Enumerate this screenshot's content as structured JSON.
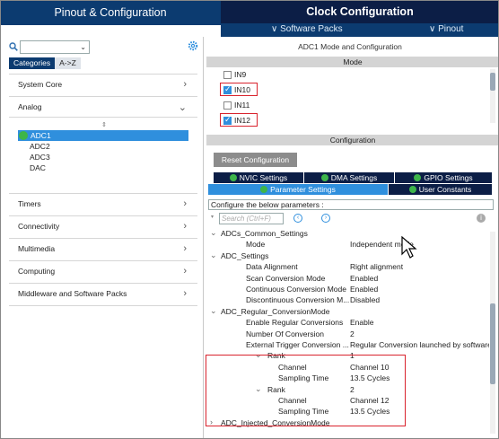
{
  "tabs": {
    "pinout": "Pinout & Configuration",
    "clock": "Clock Configuration"
  },
  "subbar": {
    "software_packs": "∨ Software Packs",
    "pinout": "∨ Pinout"
  },
  "left": {
    "category_tabs": [
      "Categories",
      "A->Z"
    ],
    "categories": [
      {
        "label": "System Core",
        "chevron": "›"
      },
      {
        "label": "Analog",
        "chevron": "⌄"
      },
      {
        "label": "Timers",
        "chevron": "›"
      },
      {
        "label": "Connectivity",
        "chevron": "›"
      },
      {
        "label": "Multimedia",
        "chevron": "›"
      },
      {
        "label": "Computing",
        "chevron": "›"
      },
      {
        "label": "Middleware and Software Packs",
        "chevron": "›"
      }
    ],
    "analog_items": [
      "ADC1",
      "ADC2",
      "ADC3",
      "DAC"
    ],
    "selected_item": "ADC1"
  },
  "right": {
    "title": "ADC1 Mode and Configuration",
    "mode_header": "Mode",
    "mode_items": [
      {
        "label": "IN9",
        "checked": false
      },
      {
        "label": "IN10",
        "checked": true
      },
      {
        "label": "IN11",
        "checked": false
      },
      {
        "label": "IN12",
        "checked": true
      }
    ],
    "config_header": "Configuration",
    "reset_button": "Reset Configuration",
    "settings_tabs_row1": [
      "NVIC Settings",
      "DMA Settings",
      "GPIO Settings"
    ],
    "settings_tabs_row2": [
      "Parameter Settings",
      "User Constants"
    ],
    "active_tab": "Parameter Settings",
    "configure_label": "Configure the below parameters :",
    "search_placeholder": "Search (Ctrl+F)",
    "params": [
      {
        "indent": 0,
        "toggle": "⌄",
        "name": "ADCs_Common_Settings",
        "value": ""
      },
      {
        "indent": 2,
        "toggle": "",
        "name": "Mode",
        "value": "Independent mode"
      },
      {
        "indent": 0,
        "toggle": "⌄",
        "name": "ADC_Settings",
        "value": ""
      },
      {
        "indent": 2,
        "toggle": "",
        "name": "Data Alignment",
        "value": "Right alignment"
      },
      {
        "indent": 2,
        "toggle": "",
        "name": "Scan Conversion Mode",
        "value": "Enabled"
      },
      {
        "indent": 2,
        "toggle": "",
        "name": "Continuous Conversion Mode",
        "value": "Enabled"
      },
      {
        "indent": 2,
        "toggle": "",
        "name": "Discontinuous Conversion M...",
        "value": "Disabled"
      },
      {
        "indent": 0,
        "toggle": "⌄",
        "name": "ADC_Regular_ConversionMode",
        "value": ""
      },
      {
        "indent": 2,
        "toggle": "",
        "name": "Enable Regular Conversions",
        "value": "Enable"
      },
      {
        "indent": 2,
        "toggle": "",
        "name": "Number Of Conversion",
        "value": "2"
      },
      {
        "indent": 2,
        "toggle": "",
        "name": "External Trigger Conversion ...",
        "value": "Regular Conversion launched by software"
      },
      {
        "indent": 3,
        "toggle": "⌄",
        "name": "Rank",
        "value": "1"
      },
      {
        "indent": 4,
        "toggle": "",
        "name": "Channel",
        "value": "Channel 10"
      },
      {
        "indent": 4,
        "toggle": "",
        "name": "Sampling Time",
        "value": "13.5 Cycles"
      },
      {
        "indent": 3,
        "toggle": "⌄",
        "name": "Rank",
        "value": "2"
      },
      {
        "indent": 4,
        "toggle": "",
        "name": "Channel",
        "value": "Channel 12"
      },
      {
        "indent": 4,
        "toggle": "",
        "name": "Sampling Time",
        "value": "13.5 Cycles"
      },
      {
        "indent": 0,
        "toggle": "›",
        "name": "ADC_Injected_ConversionMode",
        "value": ""
      }
    ]
  },
  "colors": {
    "header_dark": "#0c1e46",
    "header_blue": "#0c3b70",
    "accent": "#2f8fdd",
    "highlight_box": "#d9232d",
    "check_green": "#3db54a"
  }
}
